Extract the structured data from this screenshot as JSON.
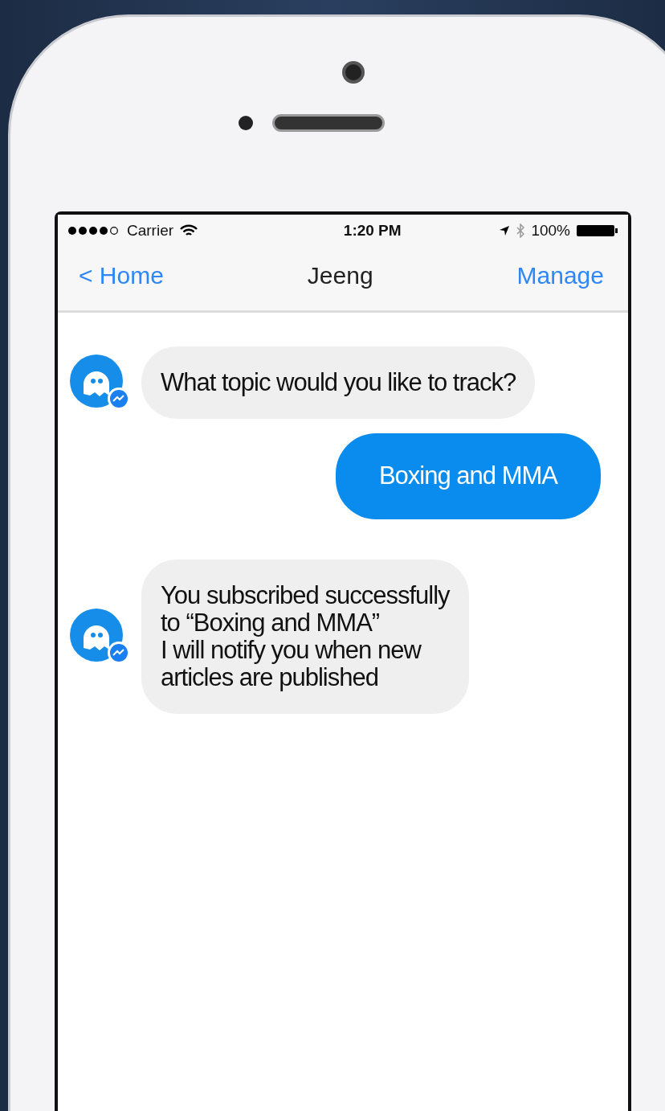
{
  "status_bar": {
    "carrier": "Carrier",
    "time": "1:20 PM",
    "battery": "100%"
  },
  "nav": {
    "back": "< Home",
    "title": "Jeeng",
    "action": "Manage"
  },
  "messages": [
    {
      "kind": "incoming",
      "text": "What topic would you like to track?"
    },
    {
      "kind": "outgoing",
      "text": "Boxing and MMA"
    },
    {
      "kind": "incoming",
      "text": "You subscribed successfully\nto “Boxing and MMA”\nI will notify you when new\narticles are published"
    }
  ]
}
